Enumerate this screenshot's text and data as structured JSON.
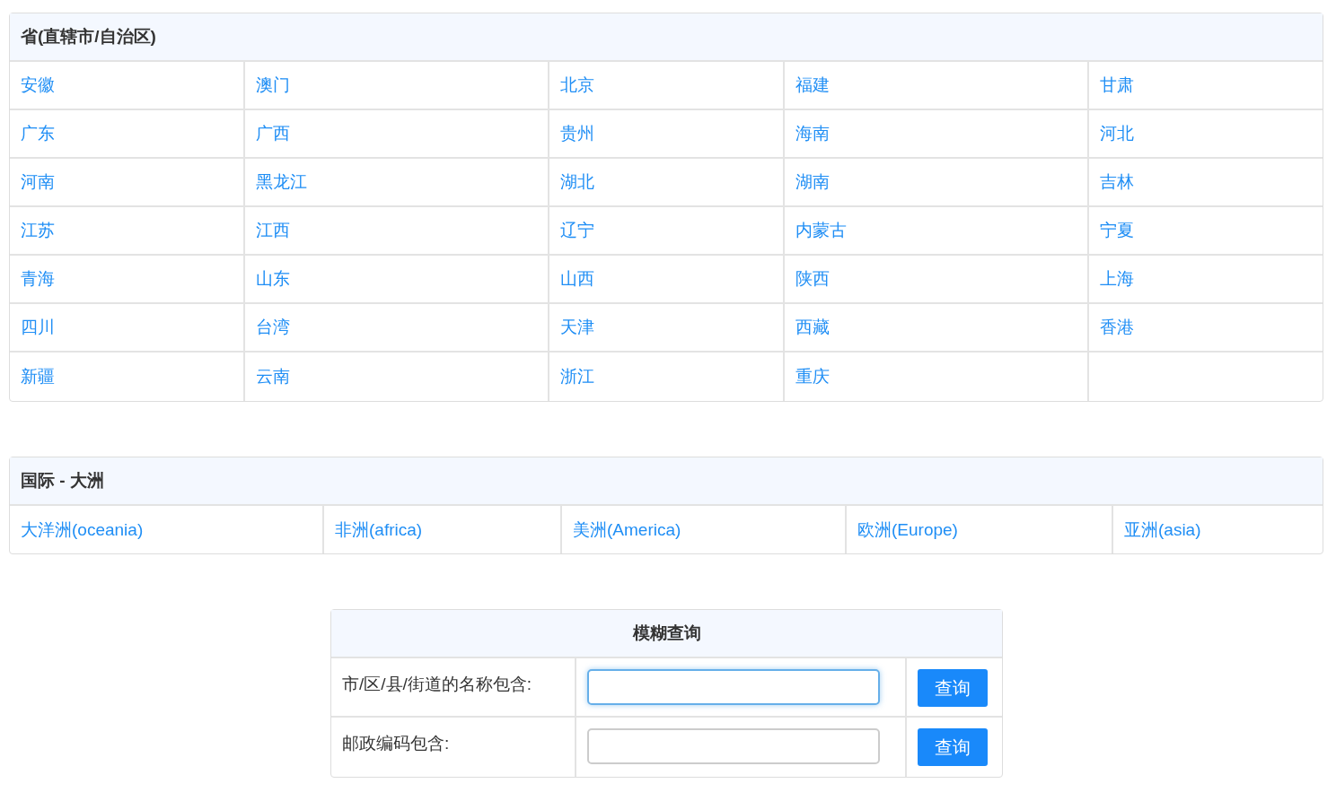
{
  "provinces": {
    "title": "省(直辖市/自治区)",
    "rows": [
      [
        "安徽",
        "澳门",
        "北京",
        "福建",
        "甘肃"
      ],
      [
        "广东",
        "广西",
        "贵州",
        "海南",
        "河北"
      ],
      [
        "河南",
        "黑龙江",
        "湖北",
        "湖南",
        "吉林"
      ],
      [
        "江苏",
        "江西",
        "辽宁",
        "内蒙古",
        "宁夏"
      ],
      [
        "青海",
        "山东",
        "山西",
        "陕西",
        "上海"
      ],
      [
        "四川",
        "台湾",
        "天津",
        "西藏",
        "香港"
      ],
      [
        "新疆",
        "云南",
        "浙江",
        "重庆"
      ]
    ]
  },
  "international": {
    "title": "国际 - 大洲",
    "rows": [
      [
        "大洋洲(oceania)",
        "非洲(africa)",
        "美洲(America)",
        "欧洲(Europe)",
        "亚洲(asia)"
      ]
    ]
  },
  "search": {
    "title": "模糊查询",
    "fields": [
      {
        "label": "市/区/县/街道的名称包含:",
        "focused": true,
        "button": "查询"
      },
      {
        "label": "邮政编码包含:",
        "focused": false,
        "button": "查询"
      }
    ]
  }
}
